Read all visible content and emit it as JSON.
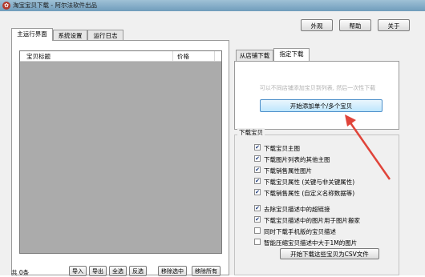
{
  "window": {
    "title": "淘宝宝贝下载 - 阿尔法软件出品"
  },
  "top_buttons": {
    "appearance": "外观",
    "help": "帮助",
    "close": "关于"
  },
  "tabs": [
    {
      "label": "主运行界面",
      "active": true
    },
    {
      "label": "系统设置",
      "active": false
    },
    {
      "label": "运行日志",
      "active": false
    }
  ],
  "list": {
    "col_title": "宝贝标题",
    "col_price": "价格"
  },
  "footer": {
    "count": "共 0条",
    "buttons": [
      "导入",
      "导出",
      "全选",
      "反选",
      "移除选中",
      "移除所有"
    ]
  },
  "right_tabs": [
    {
      "label": "从店铺下载",
      "active": false
    },
    {
      "label": "指定下载",
      "active": true
    }
  ],
  "specify": {
    "hint": "可以不同店铺添加宝贝到列表, 然后一次性下载",
    "add_button": "开始添加单个/多个宝贝"
  },
  "download_group": {
    "label": "下载宝贝",
    "options": [
      {
        "label": "下载宝贝主图",
        "checked": true
      },
      {
        "label": "下载图片列表的其他主图",
        "checked": true
      },
      {
        "label": "下载销售属性图片",
        "checked": true
      },
      {
        "label": "下载宝贝属性 (关键与非关键属性)",
        "checked": true
      },
      {
        "label": "下载销售属性 (自定义名称数据等)",
        "checked": true
      },
      {
        "label": "去除宝贝描述中的超链接",
        "checked": true
      },
      {
        "label": "下载宝贝描述中的图片用于图片搬家",
        "checked": true
      },
      {
        "label": "同时下载手机版的宝贝描述",
        "checked": false
      },
      {
        "label": "智能压缩宝贝描述中大于1M的图片",
        "checked": false
      }
    ],
    "csv_button": "开始下载这些宝贝为CSV文件"
  },
  "colors": {
    "arrow": "#e0443a",
    "titlebar": "#7fa9c6",
    "list_bg": "#ababab"
  }
}
